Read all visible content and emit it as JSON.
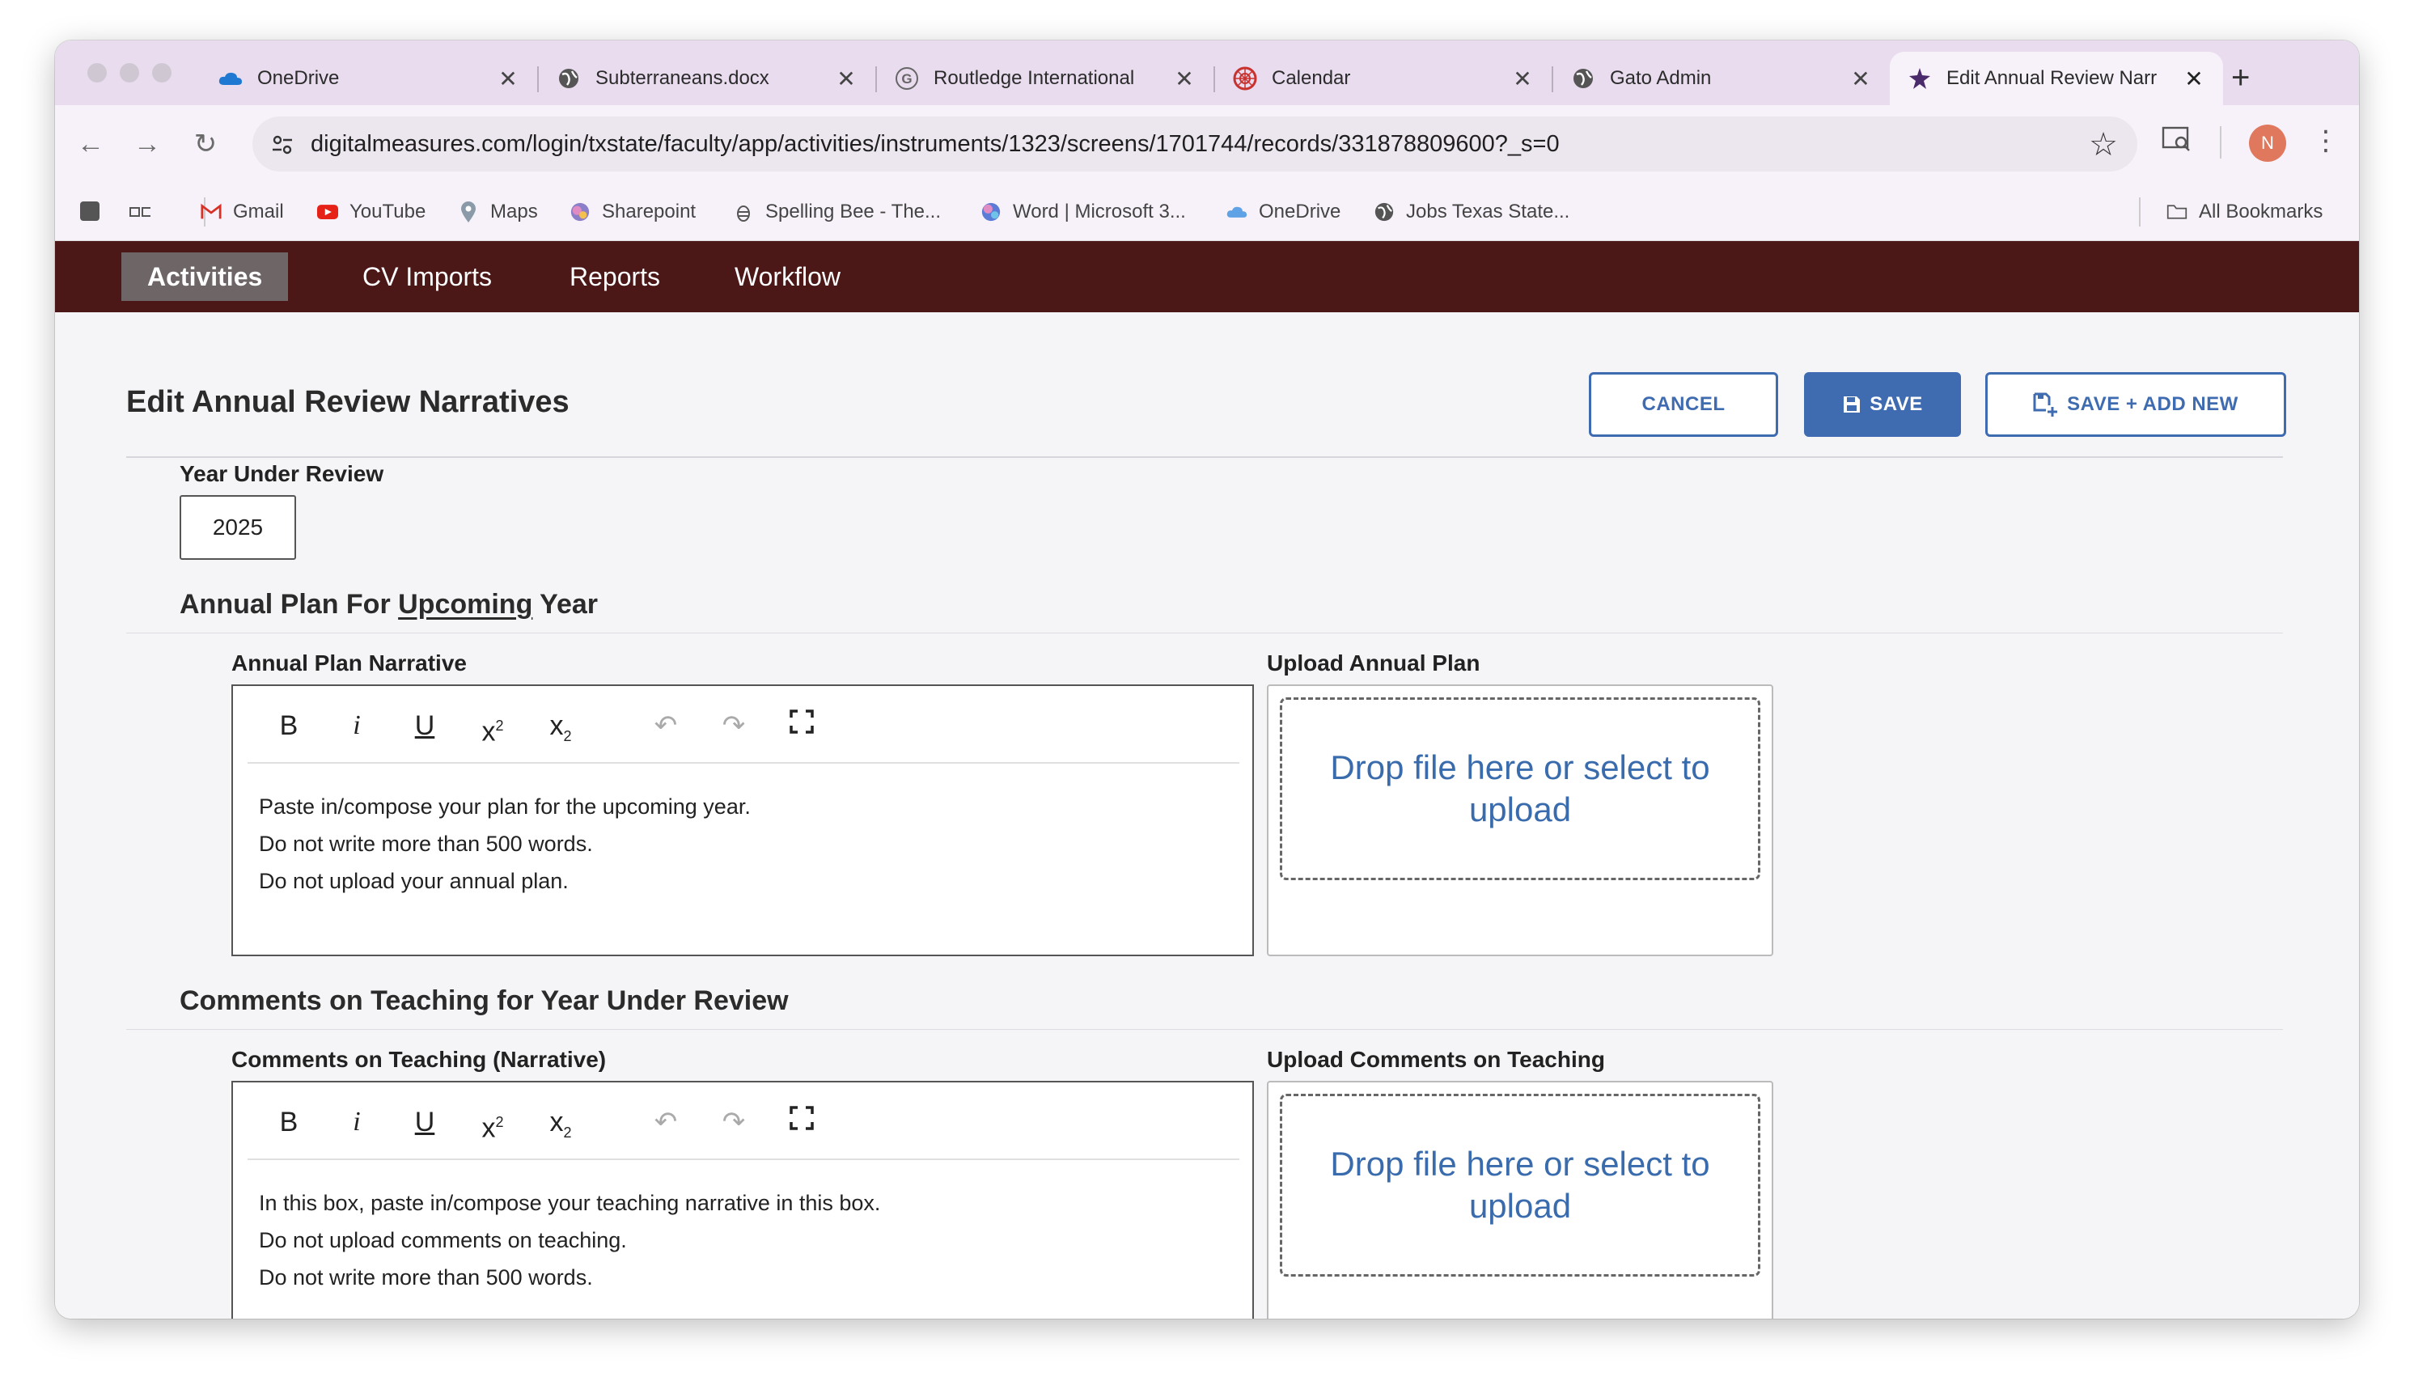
{
  "browser": {
    "tabs": [
      {
        "label": "OneDrive",
        "icon": "cloud-icon"
      },
      {
        "label": "Subterraneans.docx",
        "icon": "globe-icon"
      },
      {
        "label": "Routledge International",
        "icon": "google-icon"
      },
      {
        "label": "Calendar",
        "icon": "calendar-icon"
      },
      {
        "label": "Gato Admin",
        "icon": "globe-icon"
      },
      {
        "label": "Edit Annual Review Narr",
        "icon": "app-icon"
      }
    ],
    "url": "digitalmeasures.com/login/txstate/faculty/app/activities/instruments/1323/screens/1701744/records/331878809600?_s=0",
    "avatar_letter": "N",
    "bookmarks": [
      {
        "label": "",
        "icon": "apps-icon"
      },
      {
        "label": "Gmail",
        "icon": "gmail-icon"
      },
      {
        "label": "YouTube",
        "icon": "youtube-icon"
      },
      {
        "label": "Maps",
        "icon": "maps-icon"
      },
      {
        "label": "Sharepoint",
        "icon": "sharepoint-icon"
      },
      {
        "label": "Spelling Bee - The...",
        "icon": "bee-icon"
      },
      {
        "label": "Word | Microsoft 3...",
        "icon": "word-icon"
      },
      {
        "label": "OneDrive",
        "icon": "cloud-icon"
      },
      {
        "label": "Jobs Texas State...",
        "icon": "globe-icon"
      }
    ],
    "all_bookmarks": "All Bookmarks"
  },
  "appnav": {
    "items": [
      "Activities",
      "CV Imports",
      "Reports",
      "Workflow"
    ]
  },
  "page": {
    "title": "Edit Annual Review Narratives",
    "cancel": "CANCEL",
    "save": "SAVE",
    "save_add_new": "SAVE + ADD NEW",
    "year_label": "Year Under Review",
    "year_value": "2025"
  },
  "section1": {
    "title_pre": "Annual Plan For ",
    "title_underlined": "Upcoming",
    "title_post": " Year",
    "narrative_label": "Annual Plan Narrative",
    "upload_label": "Upload Annual Plan",
    "text": [
      "Paste in/compose your plan for the upcoming year.",
      "Do not write more than 500 words.",
      "Do not upload your annual plan."
    ],
    "drop_text": "Drop file here or select to upload"
  },
  "section2": {
    "title": "Comments on Teaching for Year Under Review",
    "narrative_label": "Comments on Teaching (Narrative)",
    "upload_label": "Upload Comments on Teaching",
    "text": [
      "In this box, paste in/compose your teaching narrative in this box.",
      "Do not upload comments on teaching.",
      "Do not write more than 500 words."
    ],
    "drop_text": "Drop file here or select to upload"
  },
  "colors": {
    "nav_bg": "#4b1717",
    "accent": "#3f6bb0",
    "tab_bg": "#e8dcee"
  }
}
